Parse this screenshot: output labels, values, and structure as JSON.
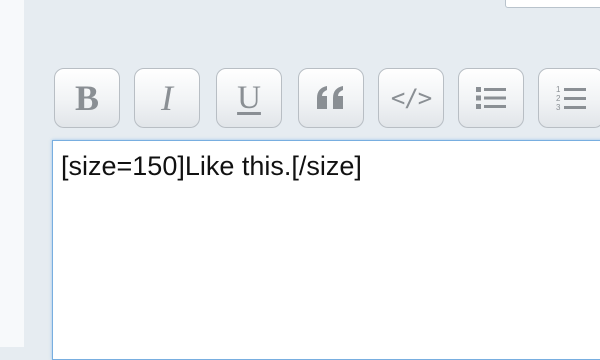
{
  "toolbar": {
    "buttons": [
      {
        "name": "bold",
        "label": "B",
        "icon": "bold-icon"
      },
      {
        "name": "italic",
        "label": "I",
        "icon": "italic-icon"
      },
      {
        "name": "underline",
        "label": "U",
        "icon": "underline-icon"
      },
      {
        "name": "quote",
        "icon": "quote-icon"
      },
      {
        "name": "code",
        "label": "</>",
        "icon": "code-icon"
      },
      {
        "name": "bullet-list",
        "icon": "bullet-list-icon"
      },
      {
        "name": "numbered-list",
        "icon": "numbered-list-icon"
      }
    ]
  },
  "editor": {
    "value": "[size=150]Like this.[/size]"
  },
  "colors": {
    "background": "#e6ecf1",
    "icon": "#8a8f94",
    "editor_border": "#78aee0"
  }
}
